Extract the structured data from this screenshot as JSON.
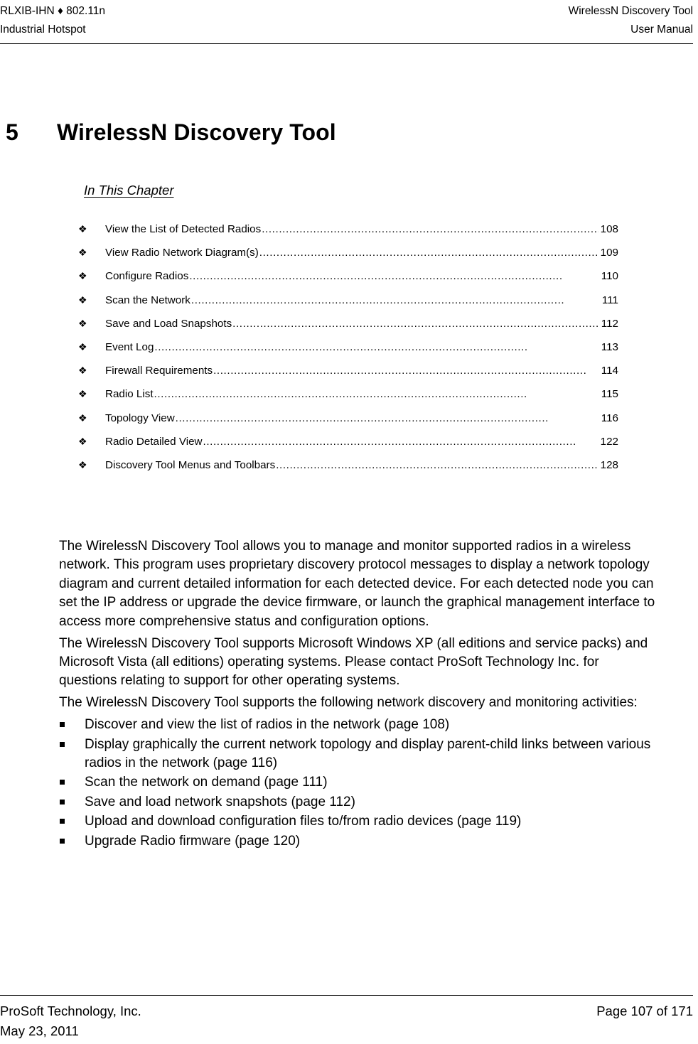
{
  "header": {
    "left_line1": "RLXIB-IHN ♦ 802.11n",
    "left_line2": "Industrial Hotspot",
    "right_line1": "WirelessN Discovery Tool",
    "right_line2": "User Manual"
  },
  "chapter": {
    "number": "5",
    "title": "WirelessN Discovery Tool"
  },
  "in_this_chapter": {
    "heading": "In This Chapter",
    "bullet_glyph": "❖",
    "entries": [
      {
        "label": "View the List of Detected Radios",
        "page": "108"
      },
      {
        "label": "View Radio Network Diagram(s)",
        "page": "109"
      },
      {
        "label": "Configure Radios",
        "page": "110"
      },
      {
        "label": "Scan the Network",
        "page": "111"
      },
      {
        "label": "Save and Load Snapshots",
        "page": "112"
      },
      {
        "label": "Event Log",
        "page": "113"
      },
      {
        "label": "Firewall Requirements",
        "page": "114"
      },
      {
        "label": "Radio List",
        "page": "115"
      },
      {
        "label": "Topology View",
        "page": "116"
      },
      {
        "label": "Radio Detailed View",
        "page": "122"
      },
      {
        "label": "Discovery Tool Menus and Toolbars",
        "page": "128"
      }
    ]
  },
  "body": {
    "paragraph1": "The WirelessN Discovery Tool allows you to manage and monitor supported radios in a wireless network. This program uses proprietary discovery protocol messages to display a network topology diagram and current detailed information for each detected device. For each detected node you can set the IP address or upgrade the device firmware, or launch the graphical management interface to access more comprehensive status and configuration options.",
    "paragraph2": "The WirelessN Discovery Tool supports Microsoft Windows XP (all editions and service packs) and Microsoft Vista (all editions) operating systems. Please contact ProSoft Technology Inc. for questions relating to support for other operating systems.",
    "paragraph3": "The WirelessN Discovery Tool supports the following network discovery and monitoring activities:",
    "activities": [
      "Discover and view the list of radios in the network (page 108)",
      "Display graphically the current network topology and display parent-child links between various radios in the network (page 116)",
      "Scan the network on demand (page 111)",
      "Save and load network snapshots (page 112)",
      "Upload and download configuration files to/from radio devices (page 119)",
      "Upgrade Radio firmware (page 120)"
    ]
  },
  "footer": {
    "left_line1": "ProSoft Technology, Inc.",
    "left_line2": "May 23, 2011",
    "right": "Page 107 of 171"
  }
}
